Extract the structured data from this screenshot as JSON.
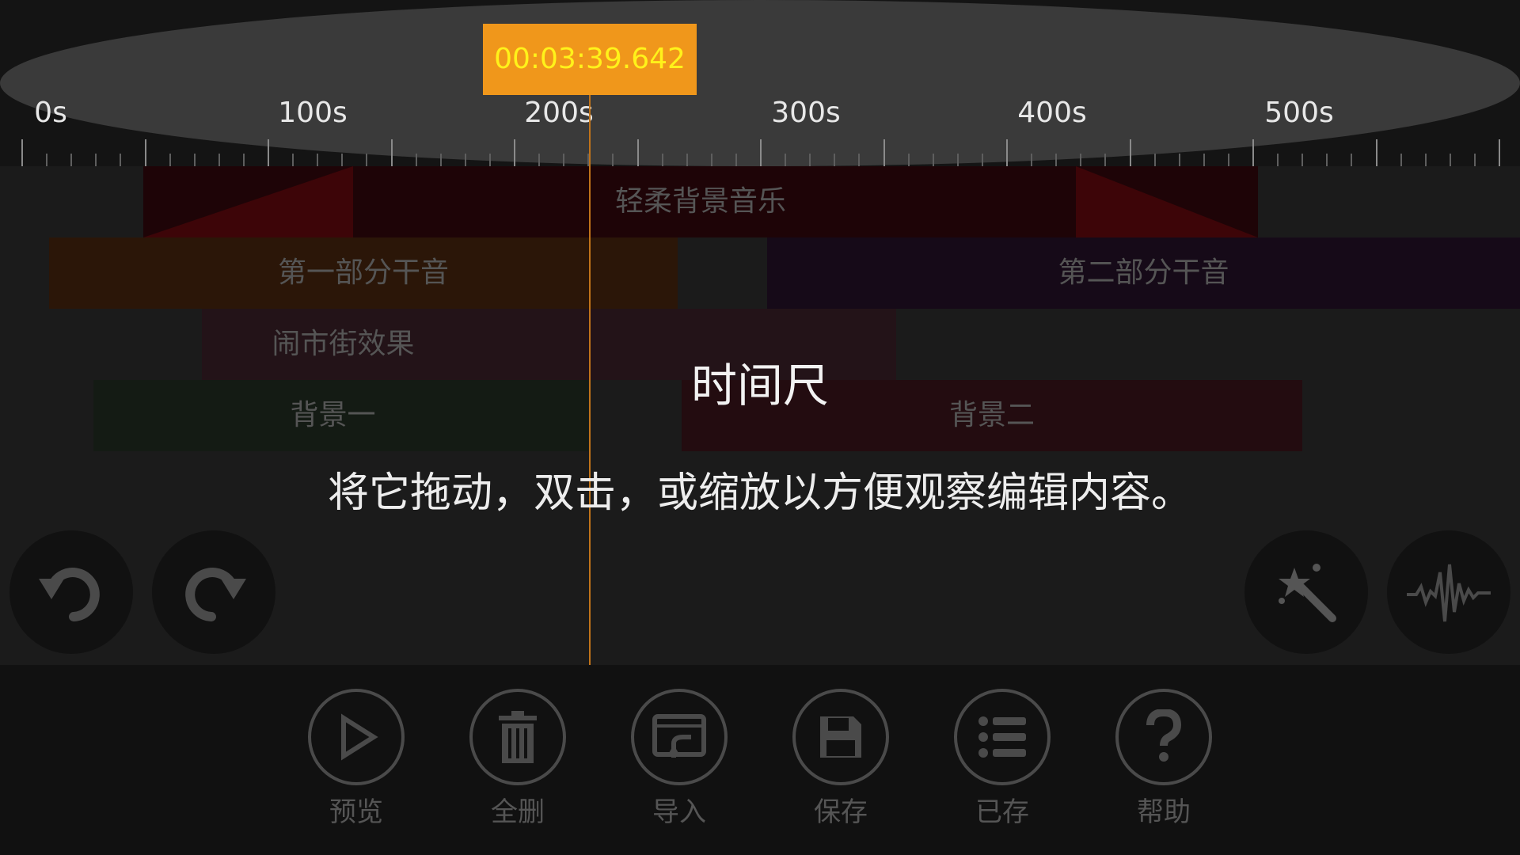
{
  "ruler": {
    "current_time": "00:03:39.642",
    "tick_labels": [
      "0s",
      "100s",
      "200s",
      "300s",
      "400s",
      "500s"
    ]
  },
  "tracks": {
    "music": {
      "label": "轻柔背景音乐"
    },
    "voice1": {
      "label": "第一部分干音"
    },
    "voice2": {
      "label": "第二部分干音"
    },
    "effect": {
      "label": "闹市街效果"
    },
    "bg1": {
      "label": "背景一"
    },
    "bg2": {
      "label": "背景二"
    }
  },
  "overlay": {
    "title": "时间尺",
    "description": "将它拖动，双击，或缩放以方便观察编辑内容。"
  },
  "controls": {
    "undo": "undo-icon",
    "redo": "redo-icon",
    "magic": "magic-wand-icon",
    "waveform": "waveform-icon"
  },
  "toolbar": {
    "preview": "预览",
    "delete_all": "全删",
    "import": "导入",
    "save": "保存",
    "saved": "已存",
    "help": "帮助"
  },
  "colors": {
    "accent": "#f0971b",
    "time_text": "#fff21a"
  }
}
